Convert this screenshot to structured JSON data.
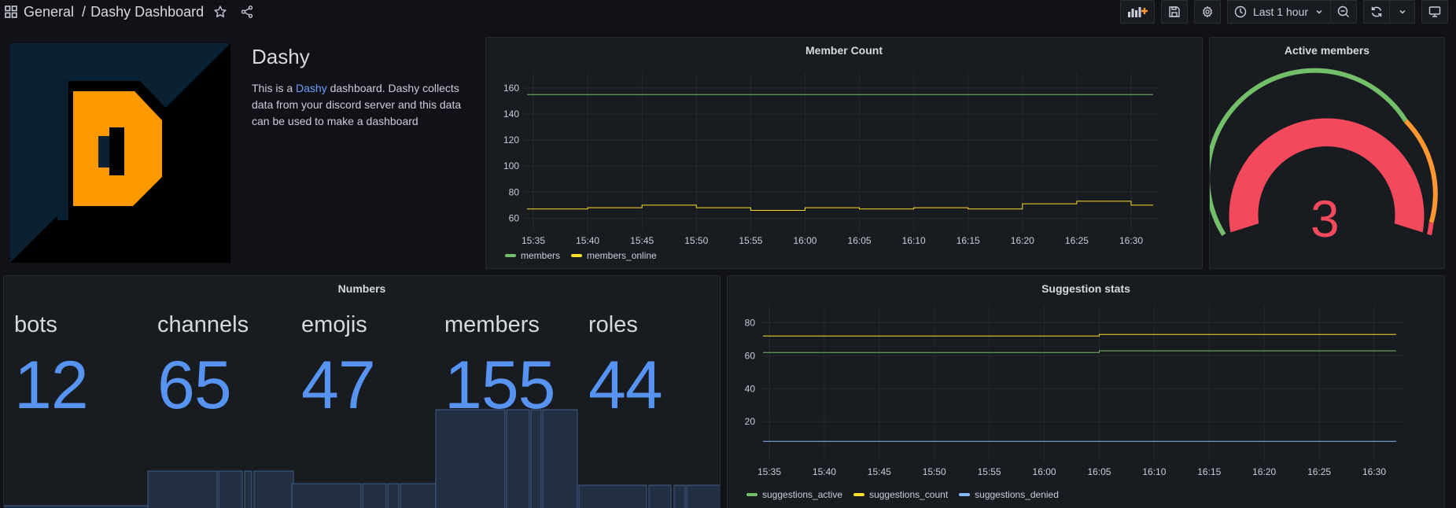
{
  "header": {
    "folder": "General",
    "separator": "/",
    "title": "Dashy Dashboard",
    "time_range": "Last 1 hour"
  },
  "text_panel": {
    "heading": "Dashy",
    "body_prefix": "This is a ",
    "link_text": "Dashy",
    "body_suffix": " dashboard. Dashy collects data from your discord server and this data can be used to make a dashboard",
    "logo_letter": "D"
  },
  "member_count": {
    "title": "Member Count",
    "legend": [
      {
        "label": "members",
        "color": "#73bf69"
      },
      {
        "label": "members_online",
        "color": "#fade2a"
      }
    ]
  },
  "active_members": {
    "title": "Active members",
    "value": "3",
    "value_color": "#f2495c"
  },
  "numbers": {
    "title": "Numbers",
    "stats": [
      {
        "label": "bots",
        "value": "12"
      },
      {
        "label": "channels",
        "value": "65"
      },
      {
        "label": "emojis",
        "value": "47"
      },
      {
        "label": "members",
        "value": "155"
      },
      {
        "label": "roles",
        "value": "44"
      }
    ]
  },
  "suggestion_stats": {
    "title": "Suggestion stats",
    "legend": [
      {
        "label": "suggestions_active",
        "color": "#73bf69"
      },
      {
        "label": "suggestions_count",
        "color": "#fade2a"
      },
      {
        "label": "suggestions_denied",
        "color": "#8ab8ff"
      }
    ]
  },
  "chart_data": [
    {
      "type": "line",
      "title": "Member Count",
      "x": [
        "15:35",
        "15:40",
        "15:45",
        "15:50",
        "15:55",
        "16:00",
        "16:05",
        "16:10",
        "16:15",
        "16:20",
        "16:25",
        "16:30"
      ],
      "ylim": [
        56,
        166
      ],
      "yticks": [
        60,
        80,
        100,
        120,
        140,
        160
      ],
      "grid": true,
      "legend_position": "bottom-left",
      "series": [
        {
          "name": "members",
          "color": "#73bf69",
          "values": [
            155,
            155,
            155,
            155,
            155,
            155,
            155,
            155,
            155,
            155,
            155,
            155
          ]
        },
        {
          "name": "members_online",
          "color": "#fade2a",
          "values": [
            67,
            68,
            70,
            68,
            66,
            68,
            67,
            68,
            67,
            71,
            73,
            70
          ]
        }
      ]
    },
    {
      "type": "line",
      "title": "Suggestion stats",
      "x": [
        "15:35",
        "15:40",
        "15:45",
        "15:50",
        "15:55",
        "16:00",
        "16:05",
        "16:10",
        "16:15",
        "16:20",
        "16:25",
        "16:30"
      ],
      "ylim": [
        0,
        86
      ],
      "yticks": [
        20,
        40,
        60,
        80
      ],
      "grid": true,
      "legend_position": "bottom-left",
      "series": [
        {
          "name": "suggestions_active",
          "color": "#73bf69",
          "values": [
            62,
            62,
            62,
            62,
            62,
            62,
            63,
            63,
            63,
            63,
            63,
            63
          ]
        },
        {
          "name": "suggestions_count",
          "color": "#fade2a",
          "values": [
            72,
            72,
            72,
            72,
            72,
            72,
            73,
            73,
            73,
            73,
            73,
            73
          ]
        },
        {
          "name": "suggestions_denied",
          "color": "#8ab8ff",
          "values": [
            8,
            8,
            8,
            8,
            8,
            8,
            8,
            8,
            8,
            8,
            8,
            8
          ]
        }
      ]
    }
  ]
}
